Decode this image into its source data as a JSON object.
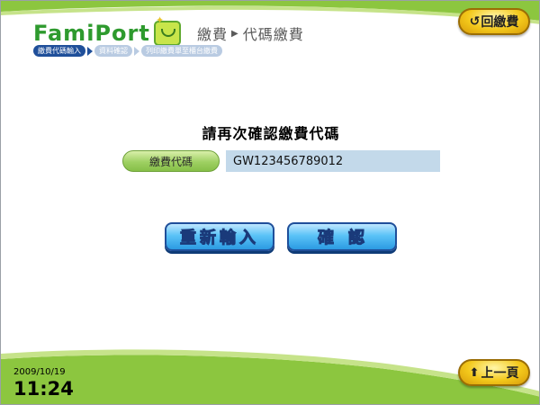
{
  "header": {
    "logo_text_a": "FamiPort",
    "title_part1": "繳費",
    "title_part2": "代碼繳費",
    "back_fee_label": "回繳費",
    "steps": [
      {
        "label": "繳費代碼輸入",
        "active": true
      },
      {
        "label": "資料確認",
        "active": false
      },
      {
        "label": "列印繳費單至櫃台繳費",
        "active": false
      }
    ]
  },
  "main": {
    "title": "請再次確認繳費代碼",
    "field_label": "繳費代碼",
    "field_value": "GW123456789012",
    "reenter_label": "重新輸入",
    "confirm_label": "確認"
  },
  "footer": {
    "date": "2009/10/19",
    "time": "11:24",
    "prev_label": "上一頁"
  },
  "colors": {
    "brand_green": "#8cc63f",
    "step_active": "#1f4f9a",
    "step_inactive": "#b9cbe2",
    "button_blue": "#2b9ae2",
    "accent_yellow": "#f3c81b"
  }
}
